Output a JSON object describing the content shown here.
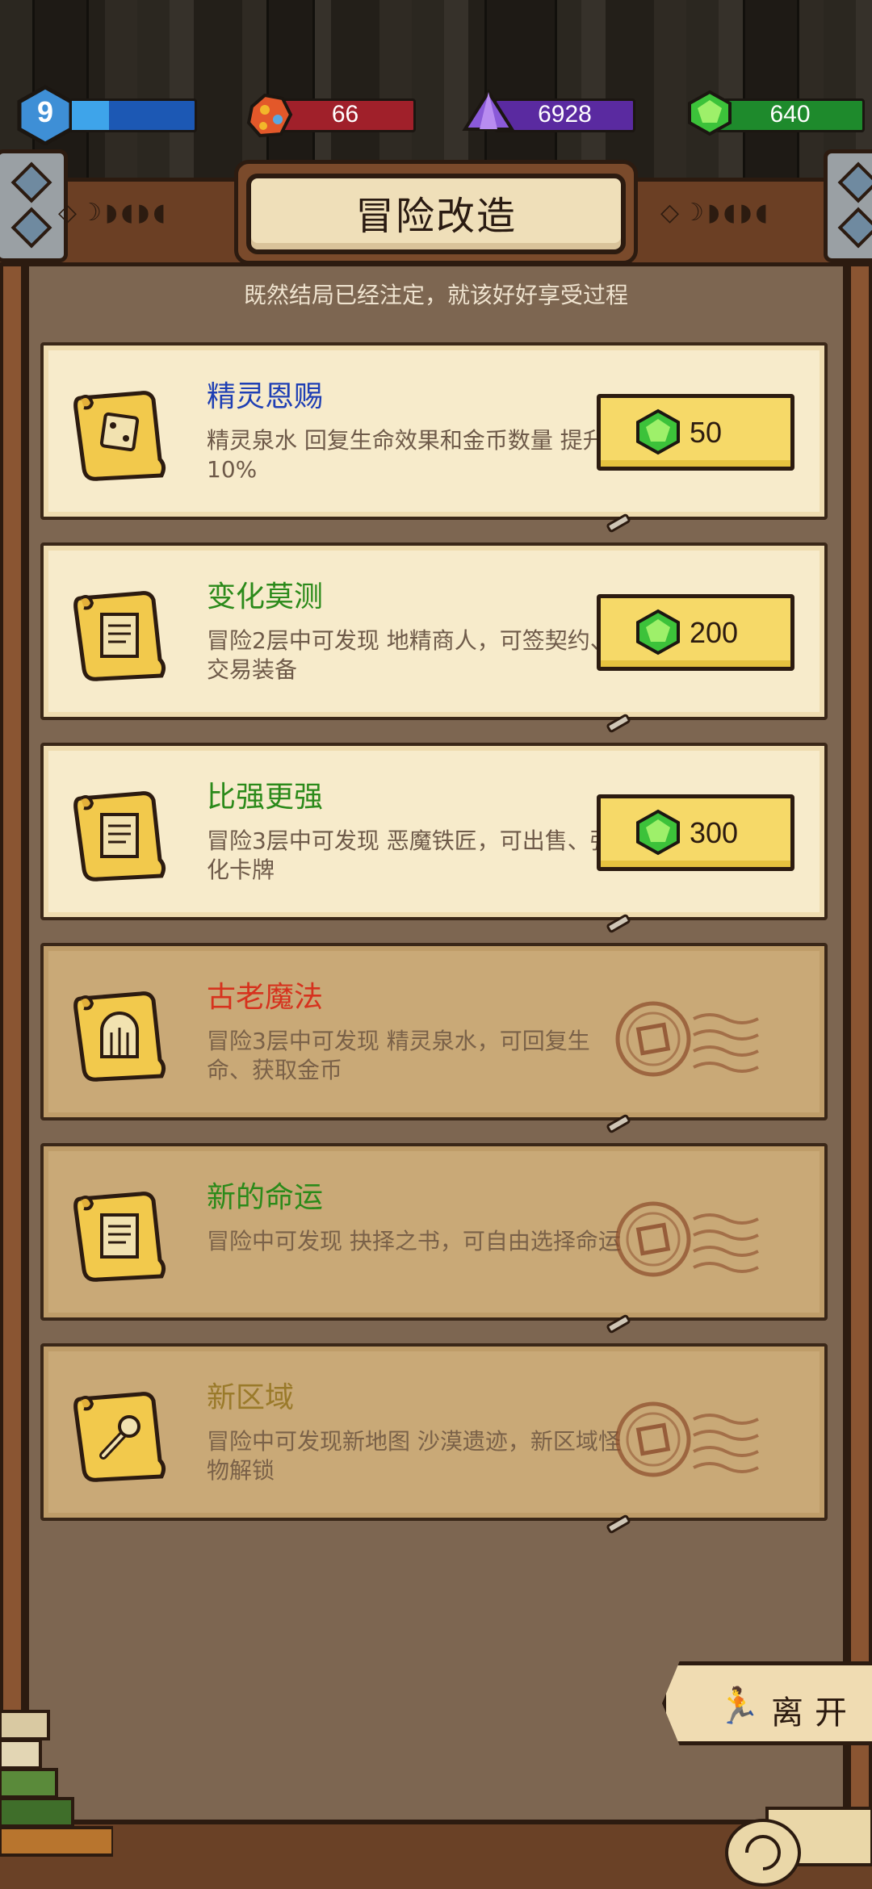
{
  "header": {
    "level": "9",
    "level_fill": 0.3,
    "ore": "66",
    "crystal": "6928",
    "gem": "640"
  },
  "title": "冒险改造",
  "subtitle": "既然结局已经注定，就该好好享受过程",
  "cards": [
    {
      "name": "精灵恩赐",
      "desc": "精灵泉水 回复生命效果和金币数量 提升 10%",
      "price": "50",
      "state": "active",
      "name_color": "#1f3fb4",
      "icon": "dice-icon"
    },
    {
      "name": "变化莫测",
      "desc": "冒险2层中可发现 地精商人，可签契约、交易装备",
      "price": "200",
      "state": "active",
      "name_color": "#2b8a1a",
      "icon": "document-icon"
    },
    {
      "name": "比强更强",
      "desc": "冒险3层中可发现 恶魔铁匠，可出售、强化卡牌",
      "price": "300",
      "state": "active",
      "name_color": "#2b8a1a",
      "icon": "document-icon"
    },
    {
      "name": "古老魔法",
      "desc": "冒险3层中可发现 精灵泉水，可回复生命、获取金币",
      "state": "locked",
      "name_color": "#d6321e",
      "icon": "arch-icon"
    },
    {
      "name": "新的命运",
      "desc": "冒险中可发现 抉择之书，可自由选择命运",
      "state": "locked",
      "name_color": "#2b8a1a",
      "icon": "document-icon"
    },
    {
      "name": "新区域",
      "desc": "冒险中可发现新地图 沙漠遗迹，新区域怪物解锁",
      "state": "locked",
      "name_color": "#9a7a2a",
      "icon": "wrench-icon"
    }
  ],
  "leave_label": "离开"
}
